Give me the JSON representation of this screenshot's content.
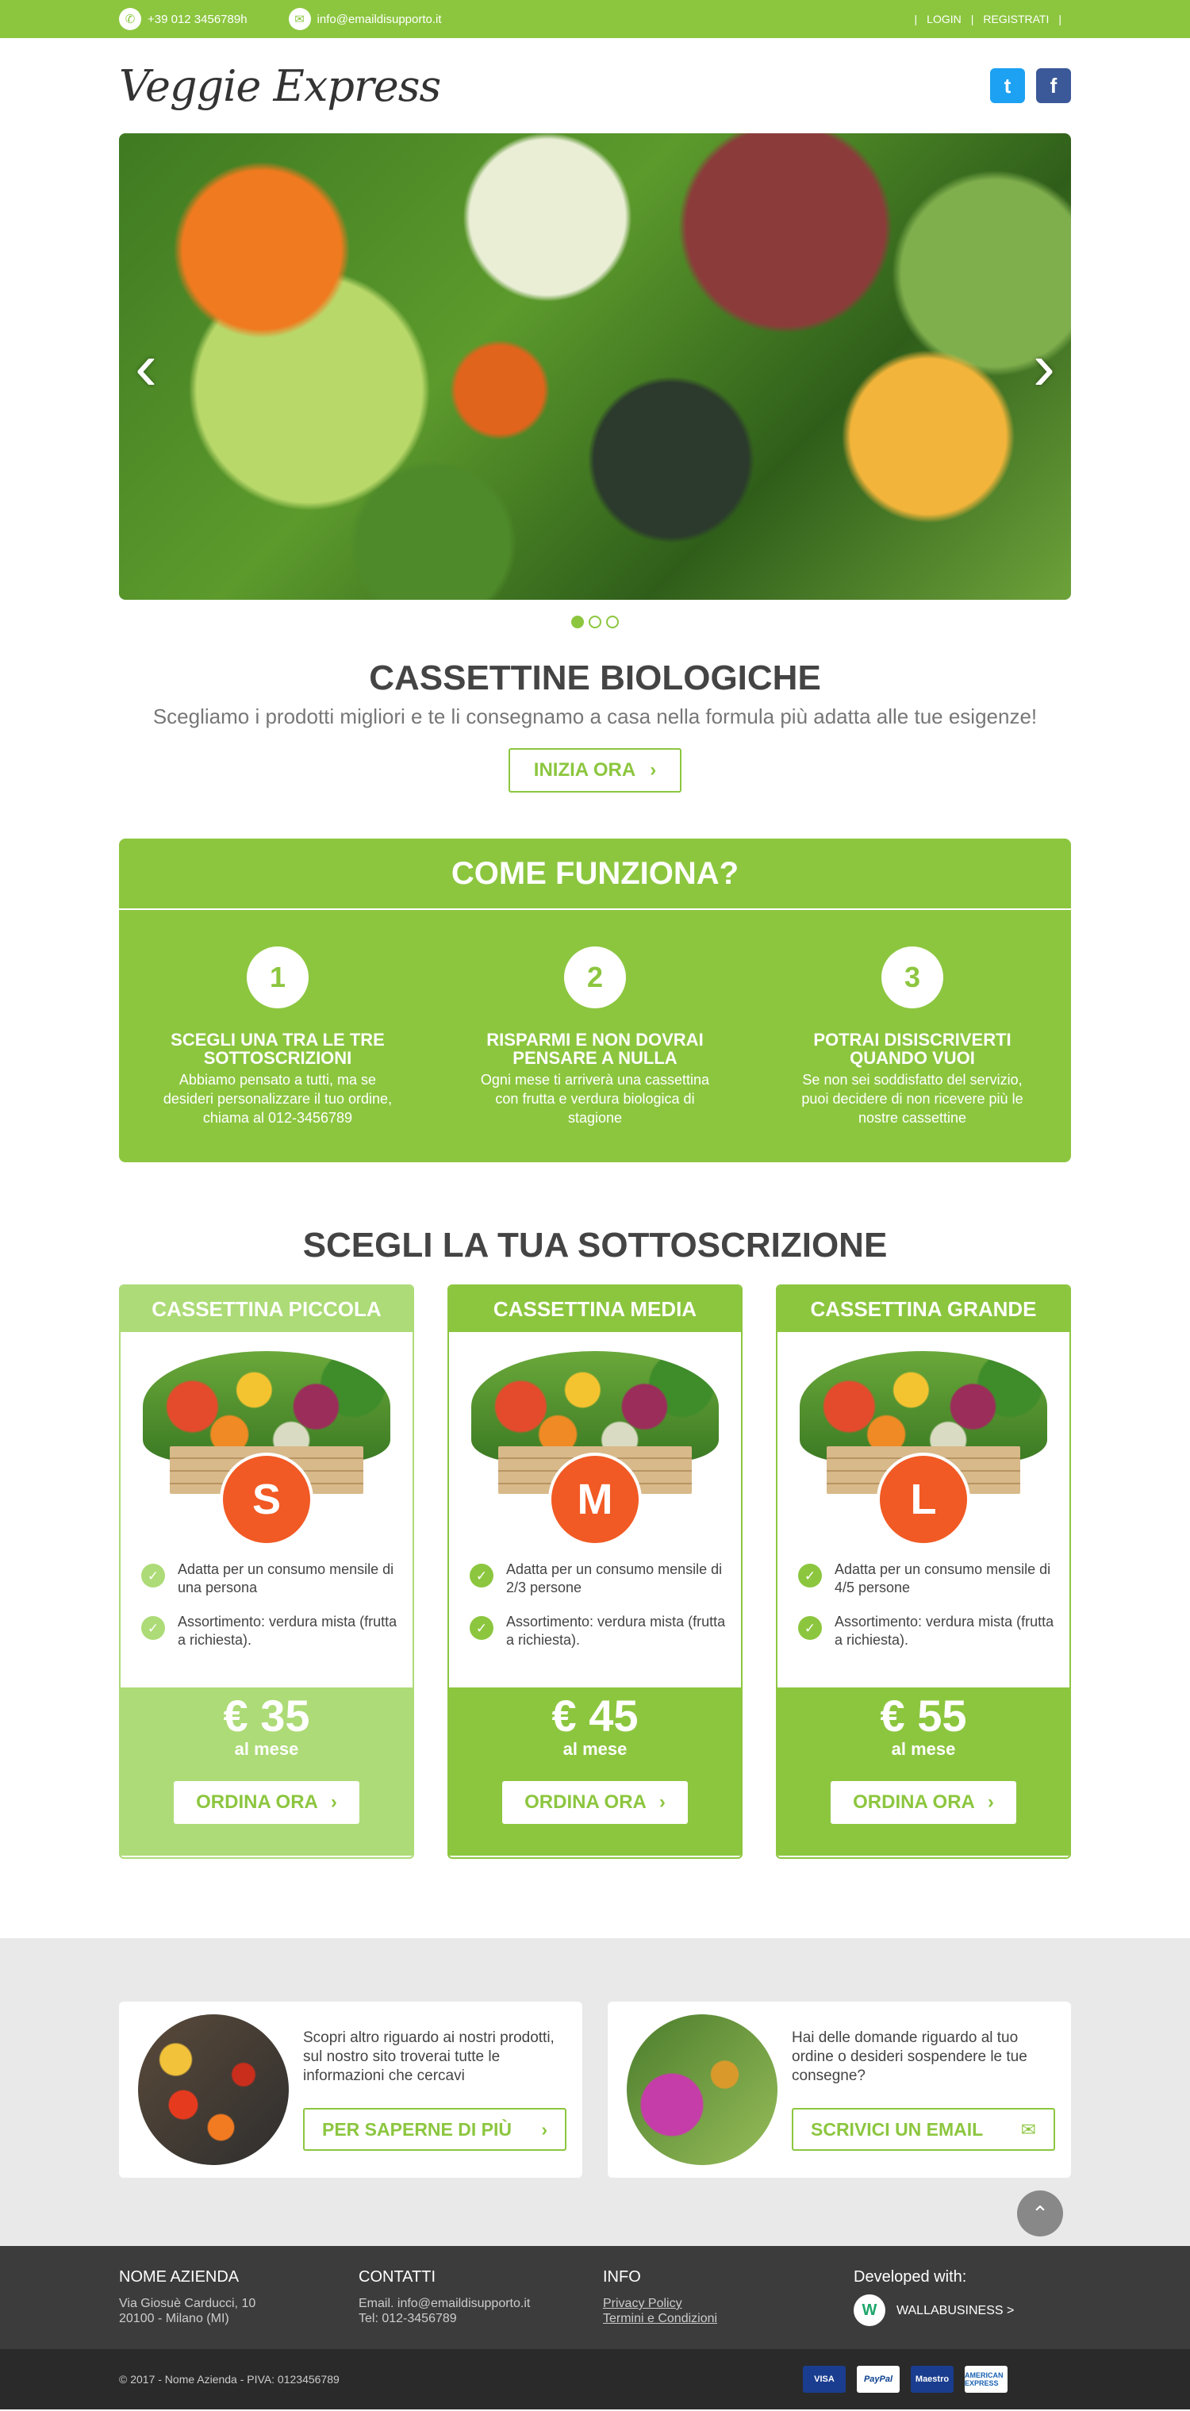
{
  "topbar": {
    "phone": "+39  012 3456789h",
    "email": "info@emaildisupporto.it",
    "login": "LOGIN",
    "register": "REGISTRATI",
    "separator": "|"
  },
  "header": {
    "logo": "Veggie Express",
    "twitter_glyph": "t",
    "facebook_glyph": "f"
  },
  "slider": {
    "prev_glyph": "‹",
    "next_glyph": "›",
    "slides": 3,
    "active": 1
  },
  "intro": {
    "title": "CASSETTINE BIOLOGICHE",
    "subtitle": "Scegliamo i prodotti migliori e te li consegnamo a casa nella formula più adatta alle tue esigenze!",
    "cta": "INIZIA ORA"
  },
  "how": {
    "title": "COME FUNZIONA?",
    "steps": [
      {
        "num": "1",
        "title": "SCEGLI UNA TRA LE TRE SOTTOSCRIZIONI",
        "text": "Abbiamo pensato a tutti, ma se desideri personalizzare il tuo ordine, chiama al 012-3456789"
      },
      {
        "num": "2",
        "title": "RISPARMI E NON DOVRAI PENSARE A NULLA",
        "text": "Ogni mese ti arriverà una cassettina con frutta e verdura biologica di stagione"
      },
      {
        "num": "3",
        "title": "POTRAI DISISCRIVERTI QUANDO VUOI",
        "text": "Se non sei soddisfatto del servizio, puoi decidere di non ricevere più le nostre cassettine"
      }
    ]
  },
  "subscriptions": {
    "title": "SCEGLI LA TUA SOTTOSCRIZIONE",
    "plans": [
      {
        "name": "CASSETTINA PICCOLA",
        "size": "S",
        "feature1": "Adatta per un consumo mensile di una persona",
        "feature2": "Assortimento: verdura mista (frutta a richiesta).",
        "price": "€ 35",
        "per": "al mese",
        "cta": "ORDINA ORA"
      },
      {
        "name": "CASSETTINA MEDIA",
        "size": "M",
        "feature1": "Adatta per un consumo mensile di 2/3 persone",
        "feature2": "Assortimento: verdura mista (frutta a richiesta).",
        "price": "€ 45",
        "per": "al mese",
        "cta": "ORDINA ORA"
      },
      {
        "name": "CASSETTINA GRANDE",
        "size": "L",
        "feature1": "Adatta per un consumo mensile di 4/5 persone",
        "feature2": "Assortimento: verdura mista (frutta a richiesta).",
        "price": "€ 55",
        "per": "al mese",
        "cta": "ORDINA ORA"
      }
    ]
  },
  "info": {
    "card1": {
      "text": "Scopri altro riguardo ai nostri prodotti, sul nostro sito troverai tutte le informazioni che cercavi",
      "cta": "PER SAPERNE DI PIÙ"
    },
    "card2": {
      "text": "Hai delle domande riguardo al tuo ordine o desideri sospendere le tue consegne?",
      "cta": "SCRIVICI UN EMAIL"
    }
  },
  "footer": {
    "company_title": "NOME AZIENDA",
    "address1": "Via Giosuè Carducci, 10",
    "address2": "20100 - Milano (MI)",
    "contacts_title": "CONTATTI",
    "contact_email": "Email. info@emaildisupporto.it",
    "contact_tel": "Tel: 012-3456789",
    "info_title": "INFO",
    "privacy": "Privacy Policy",
    "terms": "Termini e Condizioni",
    "dev_title": "Developed with:",
    "dev_link": "WALLABUSINESS >",
    "copyright": "© 2017 - Nome Azienda  - PIVA: 0123456789",
    "payments": [
      "VISA",
      "PayPal",
      "Maestro",
      "AMERICAN EXPRESS"
    ]
  },
  "colors": {
    "accent": "#8cc63f",
    "accent_light": "#addb77",
    "badge": "#f15a24",
    "footer": "#3c3c3c"
  }
}
